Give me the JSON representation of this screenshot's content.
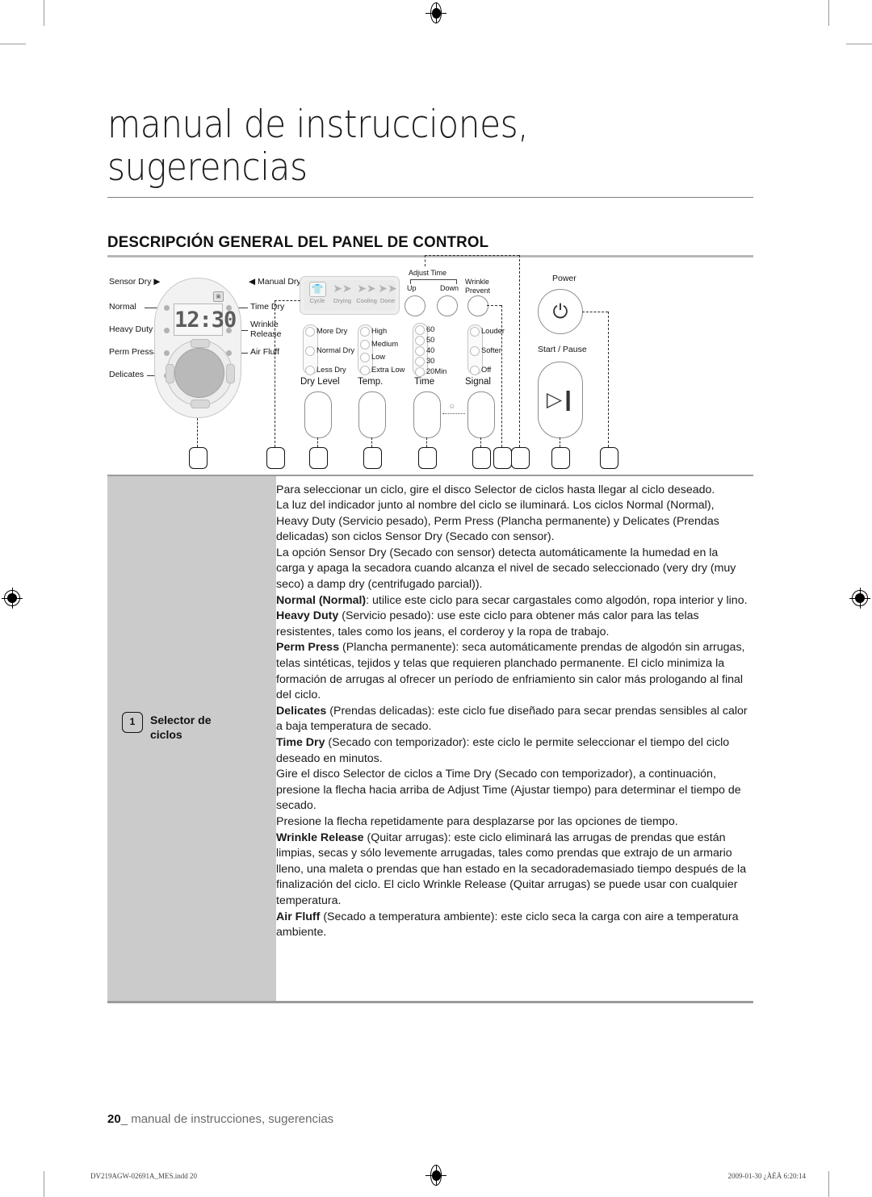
{
  "header": {
    "title_line1": "manual de instrucciones,",
    "title_line2": "sugerencias",
    "section_heading": "DESCRIPCIÓN GENERAL DEL PANEL DE CONTROL"
  },
  "diagram": {
    "dial": {
      "left_group_header": "Sensor Dry ▶",
      "right_group_header": "◀ Manual Dry",
      "left_labels": [
        "Normal",
        "Heavy Duty",
        "Perm Press",
        "Delicates"
      ],
      "right_labels": [
        "Time Dry",
        "Wrinkle Release",
        "Air Fluff"
      ],
      "display_value": "12:30",
      "display_icon": "filter-icon"
    },
    "progress": {
      "steps": [
        "Cycle",
        "Drying",
        "Cooling",
        "Done"
      ]
    },
    "columns": [
      {
        "title": "Dry Level",
        "options": [
          "More Dry",
          "Normal Dry",
          "Less Dry"
        ]
      },
      {
        "title": "Temp.",
        "options": [
          "High",
          "Medium",
          "Low",
          "Extra Low"
        ]
      },
      {
        "title": "Time",
        "options": [
          "60",
          "50",
          "40",
          "30",
          "20Min"
        ]
      },
      {
        "title": "Signal",
        "options": [
          "Louder",
          "Softer",
          "Off"
        ]
      }
    ],
    "adjust_time": {
      "group_label": "Adjust Time",
      "up": "Up",
      "down": "Down"
    },
    "wrinkle_prevent": {
      "line1": "Wrinkle",
      "line2": "Prevent"
    },
    "power": {
      "label": "Power",
      "glyph": "⏻"
    },
    "start_pause": {
      "label": "Start / Pause",
      "glyph": "▷❙"
    }
  },
  "table": {
    "badge_number": "1",
    "badge_label_line1": "Selector de",
    "badge_label_line2": "ciclos",
    "paragraphs": [
      {
        "bold": "",
        "text": "Para seleccionar un ciclo, gire el disco Selector de ciclos hasta llegar al ciclo deseado."
      },
      {
        "bold": "",
        "text": "La luz del indicador junto al nombre del ciclo se iluminará. Los ciclos Normal (Normal), Heavy Duty (Servicio pesado), Perm Press (Plancha permanente) y Delicates (Prendas delicadas) son ciclos Sensor Dry (Secado con sensor)."
      },
      {
        "bold": "",
        "text": "La opción Sensor Dry (Secado con sensor) detecta automáticamente la humedad en la carga y apaga la secadora cuando alcanza el nivel de secado seleccionado (very dry (muy seco) a damp dry (centrifugado parcial))."
      },
      {
        "bold": "Normal (Normal)",
        "text": ": utilice este ciclo para secar cargastales como algodón, ropa interior y lino."
      },
      {
        "bold": "Heavy Duty",
        "text": " (Servicio pesado): use este ciclo para obtener más calor para las telas resistentes, tales como los jeans, el corderoy y la ropa de trabajo."
      },
      {
        "bold": "Perm Press",
        "text": " (Plancha permanente): seca automáticamente prendas de algodón sin arrugas, telas sintéticas, tejidos y telas que requieren planchado permanente. El ciclo minimiza la formación de arrugas al ofrecer un período de enfriamiento sin calor más prologando al final del ciclo."
      },
      {
        "bold": "Delicates",
        "text": " (Prendas delicadas): este ciclo fue diseñado para secar prendas sensibles al calor a baja temperatura de secado."
      },
      {
        "bold": "Time Dry",
        "text": " (Secado con temporizador): este ciclo le permite seleccionar el tiempo del ciclo deseado en minutos."
      },
      {
        "bold": "",
        "text": "Gire el disco Selector de ciclos a Time Dry (Secado con temporizador), a continuación, presione la flecha hacia arriba de Adjust Time (Ajustar tiempo) para determinar el tiempo de secado."
      },
      {
        "bold": "",
        "text": "Presione la flecha repetidamente para desplazarse por las opciones de tiempo."
      },
      {
        "bold": "Wrinkle Release",
        "text": " (Quitar arrugas): este ciclo eliminará las arrugas de prendas que están limpias, secas y sólo levemente arrugadas, tales como prendas que extrajo de un armario lleno, una maleta o prendas que han estado en la secadorademasiado tiempo después de la finalización del ciclo. El ciclo Wrinkle Release (Quitar arrugas) se puede usar con cualquier temperatura."
      },
      {
        "bold": "Air Fluff",
        "text": " (Secado a temperatura ambiente): este ciclo seca la carga con aire a temperatura ambiente."
      }
    ]
  },
  "footer": {
    "page_number": "20",
    "page_text": "_ manual de instrucciones, sugerencias",
    "print_left": "DV219AGW-02691A_MES.indd   20",
    "print_right": "2009-01-30   ¿ÀÈÄ 6:20:14"
  },
  "colors": {
    "panel_grey": "#cbcbcb",
    "rule_grey": "#9b9b9b",
    "heading_rule": "#b7b7b7"
  }
}
